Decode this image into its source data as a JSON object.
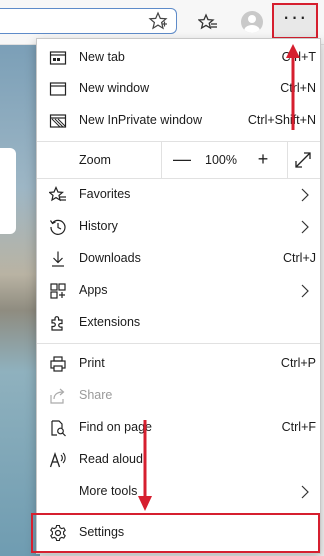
{
  "menu": {
    "new_tab": {
      "label": "New tab",
      "shortcut": "Ctrl+T"
    },
    "new_window": {
      "label": "New window",
      "shortcut": "Ctrl+N"
    },
    "inprivate": {
      "label": "New InPrivate window",
      "shortcut": "Ctrl+Shift+N"
    },
    "zoom": {
      "label": "Zoom",
      "minus": "—",
      "value": "100%",
      "plus": "+"
    },
    "favorites": {
      "label": "Favorites"
    },
    "history": {
      "label": "History"
    },
    "downloads": {
      "label": "Downloads",
      "shortcut": "Ctrl+J"
    },
    "apps": {
      "label": "Apps"
    },
    "extensions": {
      "label": "Extensions"
    },
    "print": {
      "label": "Print",
      "shortcut": "Ctrl+P"
    },
    "share": {
      "label": "Share"
    },
    "find": {
      "label": "Find on page",
      "shortcut": "Ctrl+F"
    },
    "read_aloud": {
      "label": "Read aloud"
    },
    "more_tools": {
      "label": "More tools"
    },
    "settings": {
      "label": "Settings"
    }
  },
  "toolbar": {
    "more_label": "···"
  },
  "colors": {
    "highlight": "#d61f2f",
    "address_border": "#5e8bc9"
  }
}
